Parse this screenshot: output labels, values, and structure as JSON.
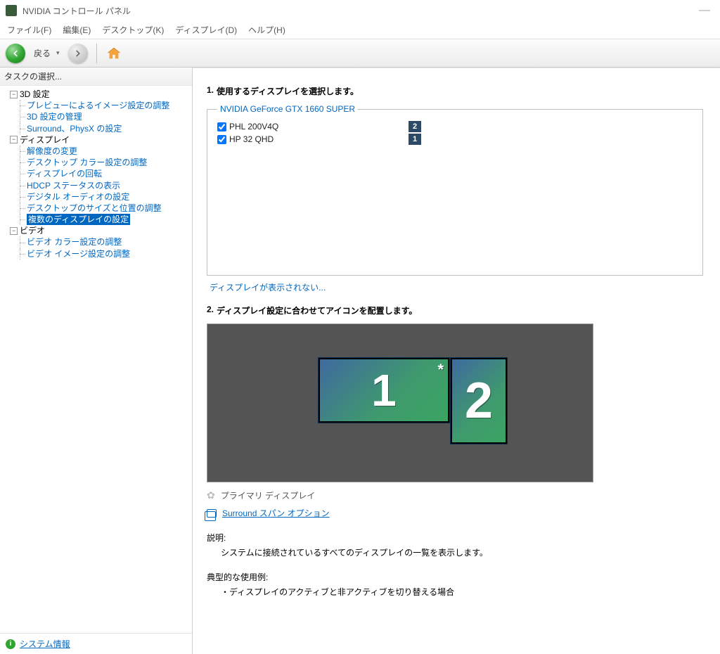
{
  "titlebar": {
    "app_title": "NVIDIA コントロール パネル"
  },
  "menubar": {
    "file": "ファイル(F)",
    "edit": "編集(E)",
    "desktop": "デスクトップ(K)",
    "display": "ディスプレイ(D)",
    "help": "ヘルプ(H)"
  },
  "toolbar": {
    "back_label": "戻る"
  },
  "sidebar": {
    "header": "タスクの選択...",
    "groups": [
      {
        "label": "3D 設定",
        "items": [
          {
            "label": "プレビューによるイメージ設定の調整"
          },
          {
            "label": "3D 設定の管理"
          },
          {
            "label": "Surround、PhysX の設定"
          }
        ]
      },
      {
        "label": "ディスプレイ",
        "items": [
          {
            "label": "解像度の変更"
          },
          {
            "label": "デスクトップ カラー設定の調整"
          },
          {
            "label": "ディスプレイの回転"
          },
          {
            "label": "HDCP ステータスの表示"
          },
          {
            "label": "デジタル オーディオの設定"
          },
          {
            "label": "デスクトップのサイズと位置の調整"
          },
          {
            "label": "複数のディスプレイの設定",
            "selected": true
          }
        ]
      },
      {
        "label": "ビデオ",
        "items": [
          {
            "label": "ビデオ カラー設定の調整"
          },
          {
            "label": "ビデオ イメージ設定の調整"
          }
        ]
      }
    ],
    "footer_link": "システム情報"
  },
  "content": {
    "step1": {
      "num": "1.",
      "title": "使用するディスプレイを選択します。"
    },
    "gpu_legend": "NVIDIA GeForce GTX 1660 SUPER",
    "displays": [
      {
        "label": "PHL 200V4Q",
        "badge": "2",
        "checked": true
      },
      {
        "label": "HP 32 QHD",
        "badge": "1",
        "checked": true
      }
    ],
    "not_shown_link": "ディスプレイが表示されない...",
    "step2": {
      "num": "2.",
      "title": "ディスプレイ設定に合わせてアイコンを配置します。"
    },
    "monitors": {
      "m1": "1",
      "m2": "2",
      "primary_mark": "*"
    },
    "primary_label": "プライマリ ディスプレイ",
    "surround_link": "Surround スパン オプション",
    "desc_head": "説明:",
    "desc_text": "システムに接続されているすべてのディスプレイの一覧を表示します。",
    "usecase_head": "典型的な使用例:",
    "usecase_text": "・ディスプレイのアクティブと非アクティブを切り替える場合"
  }
}
